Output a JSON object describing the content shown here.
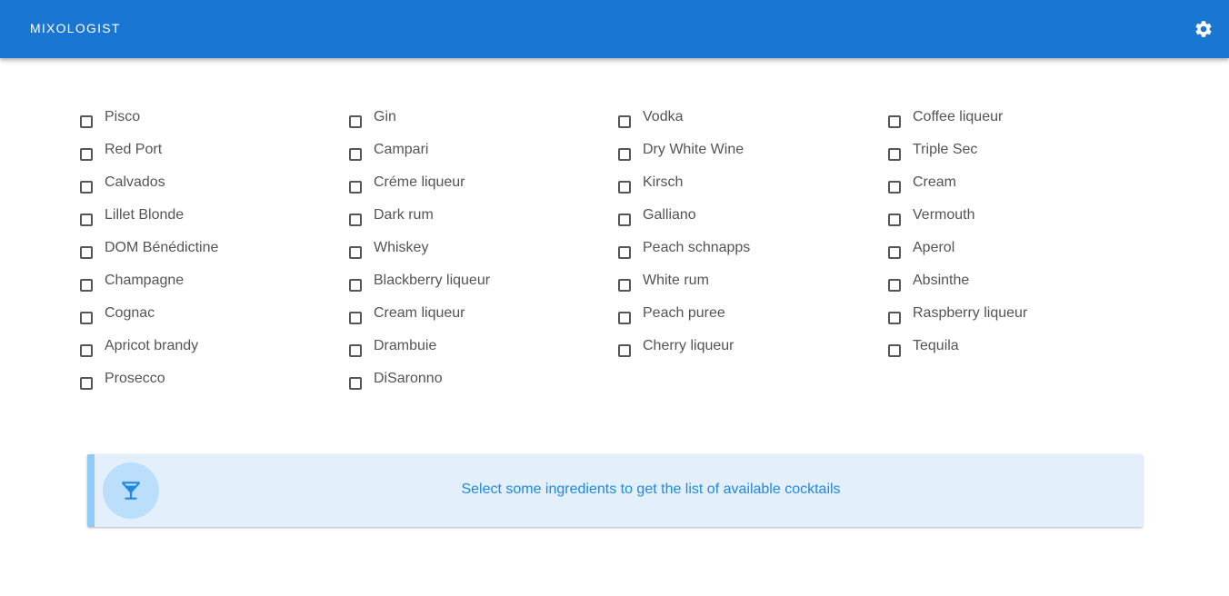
{
  "app_bar": {
    "title": "MIXOLOGIST",
    "background_color": "#1976d2",
    "settings_icon": "gear-icon"
  },
  "ingredients": {
    "columns": [
      [
        "Pisco",
        "Red Port",
        "Calvados",
        "Lillet Blonde",
        "DOM Bénédictine",
        "Champagne",
        "Cognac",
        "Apricot brandy",
        "Prosecco"
      ],
      [
        "Gin",
        "Campari",
        "Créme liqueur",
        "Dark rum",
        "Whiskey",
        "Blackberry liqueur",
        "Cream liqueur",
        "Drambuie",
        "DiSaronno"
      ],
      [
        "Vodka",
        "Dry White Wine",
        "Kirsch",
        "Galliano",
        "Peach schnapps",
        "White rum",
        "Peach puree",
        "Cherry liqueur"
      ],
      [
        "Coffee liqueur",
        "Triple Sec",
        "Cream",
        "Vermouth",
        "Aperol",
        "Absinthe",
        "Raspberry liqueur",
        "Tequila"
      ]
    ],
    "checked": false
  },
  "alert": {
    "icon": "cocktail-glass-icon",
    "message": "Select some ingredients to get the list of available cocktails",
    "text_color": "#1e88e5",
    "background_color": "#e3f0fb",
    "accent_color": "#90caf9"
  }
}
